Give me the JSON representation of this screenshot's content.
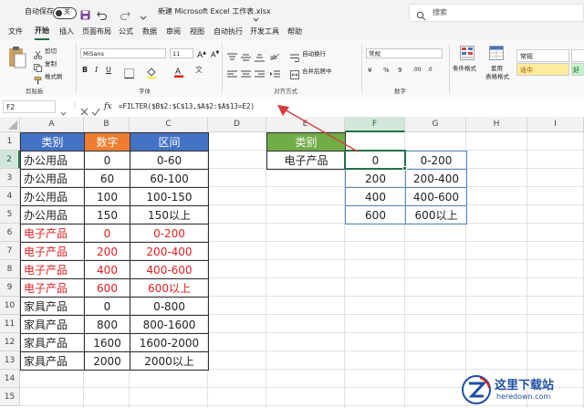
{
  "titlebar": {
    "autosave_label": "自动保存",
    "autosave_state": "关",
    "filename": "新建 Microsoft Excel 工作表.xlsx",
    "search_placeholder": "搜索"
  },
  "menu": [
    "文件",
    "开始",
    "插入",
    "页面布局",
    "公式",
    "数据",
    "审阅",
    "视图",
    "自动执行",
    "开发工具",
    "帮助"
  ],
  "menu_active": "开始",
  "ribbon": {
    "clipboard": {
      "cut": "剪切",
      "copy": "复制",
      "format_painter": "格式刷",
      "group": "剪贴板"
    },
    "font": {
      "name": "MiSans",
      "size": "11",
      "group": "字体"
    },
    "alignment": {
      "wrap": "自动换行",
      "merge": "合并后居中",
      "group": "对齐方式"
    },
    "number": {
      "format": "常规",
      "group": "数字"
    },
    "styles": {
      "conditional": "条件格式",
      "table_fmt_1": "套用",
      "table_fmt_2": "表格格式",
      "normal": "常规",
      "neutral": "适中",
      "extra": "好"
    }
  },
  "formula_bar": {
    "name_box": "F2",
    "fx": "fx",
    "formula": "=FILTER($B$2:$C$13,$A$2:$A$13=E2)"
  },
  "columns": [
    "A",
    "B",
    "C",
    "D",
    "E",
    "F",
    "G",
    "H",
    "I"
  ],
  "selected_column": "F",
  "rows": [
    "1",
    "2",
    "3",
    "4",
    "5",
    "6",
    "7",
    "8",
    "9",
    "10",
    "11",
    "12",
    "13",
    "14",
    "15"
  ],
  "selected_row": "2",
  "source_table": {
    "headers": [
      "类别",
      "数字",
      "区间"
    ],
    "header_colors": [
      "#4472c4",
      "#ed7d31",
      "#4472c4"
    ],
    "rows": [
      {
        "cat": "办公用品",
        "num": "0",
        "range": "0-60",
        "red": false
      },
      {
        "cat": "办公用品",
        "num": "60",
        "range": "60-100",
        "red": false
      },
      {
        "cat": "办公用品",
        "num": "100",
        "range": "100-150",
        "red": false
      },
      {
        "cat": "办公用品",
        "num": "150",
        "range": "150以上",
        "red": false
      },
      {
        "cat": "电子产品",
        "num": "0",
        "range": "0-200",
        "red": true
      },
      {
        "cat": "电子产品",
        "num": "200",
        "range": "200-400",
        "red": true
      },
      {
        "cat": "电子产品",
        "num": "400",
        "range": "400-600",
        "red": true
      },
      {
        "cat": "电子产品",
        "num": "600",
        "range": "600以上",
        "red": true
      },
      {
        "cat": "家具产品",
        "num": "0",
        "range": "0-800",
        "red": false
      },
      {
        "cat": "家具产品",
        "num": "800",
        "range": "800-1600",
        "red": false
      },
      {
        "cat": "家具产品",
        "num": "1600",
        "range": "1600-2000",
        "red": false
      },
      {
        "cat": "家具产品",
        "num": "2000",
        "range": "2000以上",
        "red": false
      }
    ]
  },
  "lookup": {
    "header": "类别",
    "header_color": "#70ad47",
    "criteria": "电子产品"
  },
  "result": [
    {
      "num": "0",
      "range": "0-200"
    },
    {
      "num": "200",
      "range": "200-400"
    },
    {
      "num": "400",
      "range": "400-600"
    },
    {
      "num": "600",
      "range": "600以上"
    }
  ],
  "accent": "#217346",
  "arrow_color": "#d63b3b",
  "watermark": {
    "line1": "这里下载站",
    "line2": "heredown.com"
  }
}
